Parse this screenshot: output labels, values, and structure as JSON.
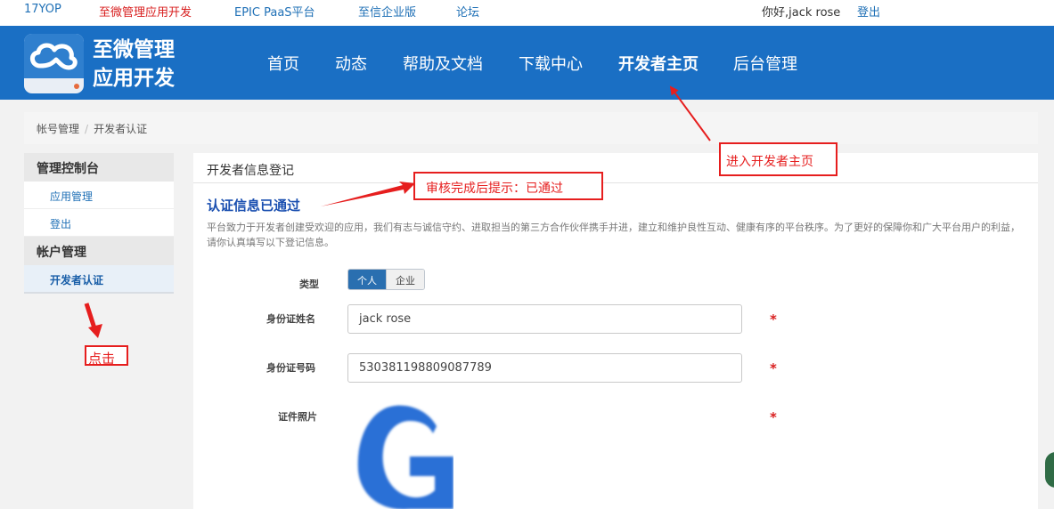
{
  "topbar": {
    "link_17yop": "17YOP",
    "link_zhiwei": "至微管理应用开发",
    "link_epic": "EPIC PaaS平台",
    "link_enterprise": "至信企业版",
    "link_forum": "论坛",
    "greeting": "你好,jack rose",
    "logout": "登出"
  },
  "header": {
    "logo_line1": "至微管理",
    "logo_line2": "应用开发",
    "nav": [
      "首页",
      "动态",
      "帮助及文档",
      "下载中心",
      "开发者主页",
      "后台管理"
    ],
    "active_nav": "开发者主页",
    "accent_color": "#1a6fc4"
  },
  "breadcrumb": {
    "item1": "帐号管理",
    "separator": "/",
    "item2": "开发者认证"
  },
  "sidebar": {
    "group1_title": "管理控制台",
    "group1_items": [
      "应用管理",
      "登出"
    ],
    "group2_title": "帐户管理",
    "group2_items": [
      "开发者认证"
    ]
  },
  "main": {
    "panel_title": "开发者信息登记",
    "status": "认证信息已通过",
    "description": "平台致力于开发者创建受欢迎的应用，我们有志与诚信守约、进取担当的第三方合作伙伴携手并进，建立和维护良性互动、健康有序的平台秩序。为了更好的保障你和广大平台用户的利益，请你认真填写以下登记信息。",
    "form": {
      "type_label": "类型",
      "type_options": [
        "个人",
        "企业"
      ],
      "type_selected": "个人",
      "name_label": "身份证姓名",
      "name_value": "jack rose",
      "id_label": "身份证号码",
      "id_value": "530381198809087789",
      "photo_label": "证件照片",
      "required_mark": "*"
    }
  },
  "annotations": {
    "developer_home": "进入开发者主页",
    "audit_done": "审核完成后提示：已通过",
    "click": "点击"
  },
  "icons": {
    "logo": "cloud-icon",
    "id_photo": "letter-g-image"
  }
}
